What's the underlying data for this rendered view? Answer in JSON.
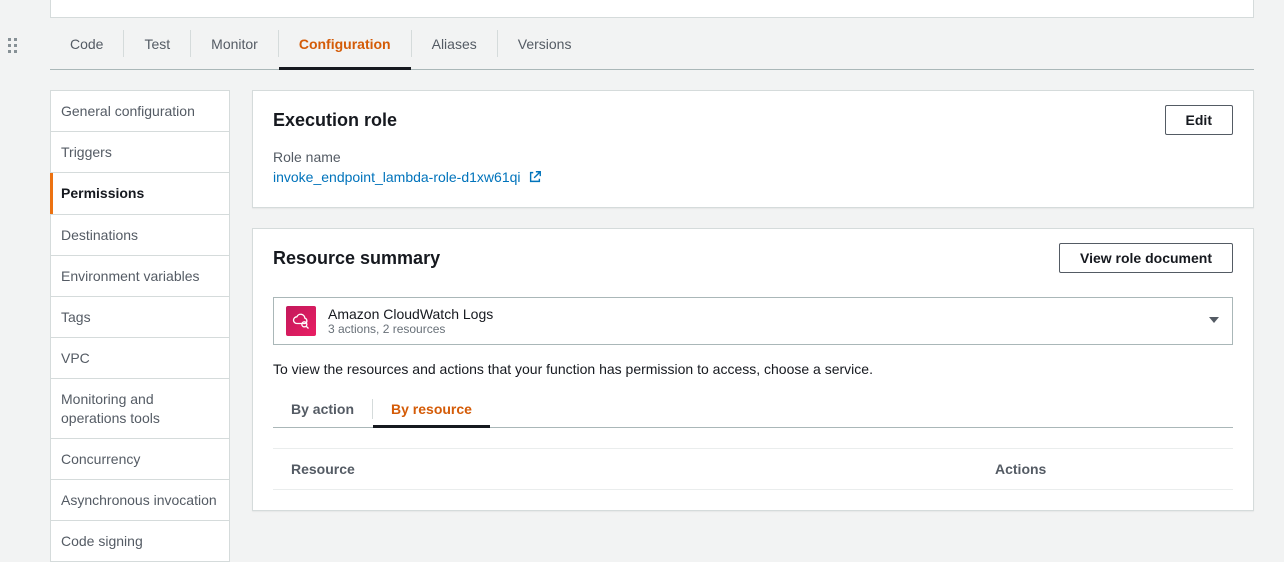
{
  "tabs": [
    {
      "label": "Code"
    },
    {
      "label": "Test"
    },
    {
      "label": "Monitor"
    },
    {
      "label": "Configuration",
      "active": true
    },
    {
      "label": "Aliases"
    },
    {
      "label": "Versions"
    }
  ],
  "sidebar": {
    "items": [
      "General configuration",
      "Triggers",
      "Permissions",
      "Destinations",
      "Environment variables",
      "Tags",
      "VPC",
      "Monitoring and operations tools",
      "Concurrency",
      "Asynchronous invocation",
      "Code signing"
    ],
    "active_index": 2
  },
  "execution_role": {
    "title": "Execution role",
    "edit_label": "Edit",
    "field_label": "Role name",
    "role_name": "invoke_endpoint_lambda-role-d1xw61qi"
  },
  "resource_summary": {
    "title": "Resource summary",
    "view_doc_label": "View role document",
    "service": {
      "name": "Amazon CloudWatch Logs",
      "subtitle": "3 actions, 2 resources"
    },
    "hint": "To view the resources and actions that your function has permission to access, choose a service.",
    "subtabs": [
      {
        "label": "By action"
      },
      {
        "label": "By resource",
        "active": true
      }
    ],
    "columns": {
      "resource": "Resource",
      "actions": "Actions"
    }
  }
}
